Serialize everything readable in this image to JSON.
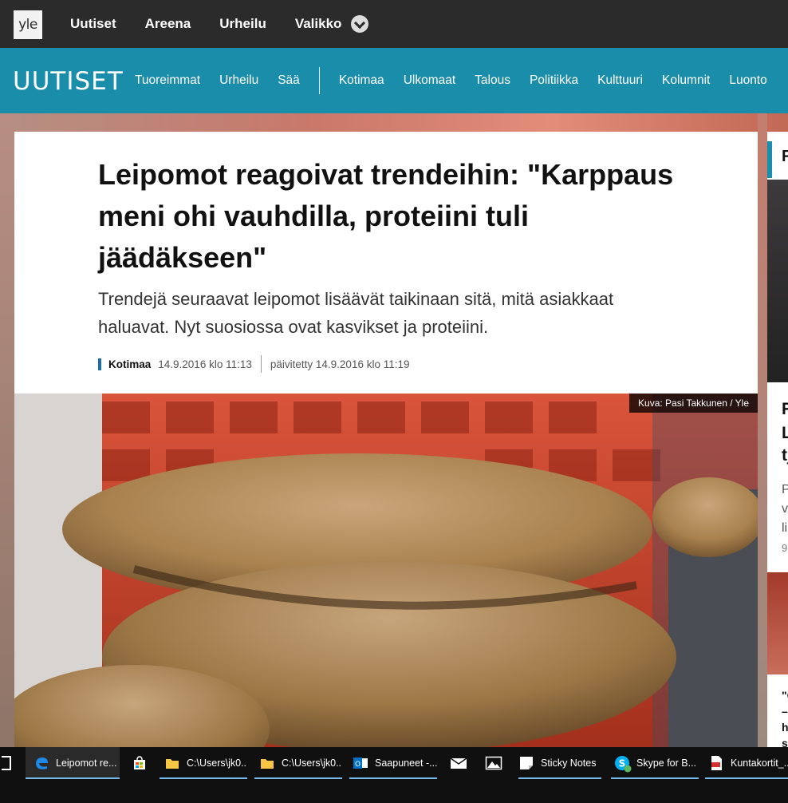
{
  "topbar": {
    "logo": "yle",
    "nav": [
      "Uutiset",
      "Areena",
      "Urheilu"
    ],
    "menu_label": "Valikko"
  },
  "section_bar": {
    "logo": "UUTISET",
    "nav_left": [
      "Tuoreimmat",
      "Urheilu",
      "Sää"
    ],
    "nav_right": [
      "Kotimaa",
      "Ulkomaat",
      "Talous",
      "Politiikka",
      "Kulttuuri",
      "Kolumnit",
      "Luonto"
    ]
  },
  "article": {
    "headline": "Leipomot reagoivat trendeihin: \"Karppaus meni ohi vauhdilla, proteiini tuli jäädäkseen\"",
    "lead": "Trendejä seuraavat leipomot lisäävät taikinaan sitä, mitä asiakkaat haluavat. Nyt suosiossa ovat kasvikset ja proteiini.",
    "category": "Kotimaa",
    "published": "14.9.2016 klo 11:13",
    "updated": "päivitetty 14.9.2016 klo 11:19",
    "photo_credit": "Kuva: Pasi Takkunen / Yle"
  },
  "sidebar": {
    "fragments": [
      "F",
      "L",
      "tj",
      "P",
      "v",
      "li",
      "9",
      "\"C",
      "–",
      "h",
      "s"
    ]
  },
  "taskbar": {
    "items": [
      {
        "label": "Leipomot re...",
        "icon": "edge-icon"
      },
      {
        "label": "",
        "icon": "store-icon"
      },
      {
        "label": "C:\\Users\\jk0...",
        "icon": "folder-icon"
      },
      {
        "label": "C:\\Users\\jk0...",
        "icon": "folder-icon"
      },
      {
        "label": "Saapuneet -...",
        "icon": "outlook-icon"
      },
      {
        "label": "",
        "icon": "mail-icon"
      },
      {
        "label": "",
        "icon": "photos-icon"
      },
      {
        "label": "Sticky Notes",
        "icon": "sticky-notes-icon"
      },
      {
        "label": "Skype for B...",
        "icon": "skype-icon"
      },
      {
        "label": "Kuntakortit_...",
        "icon": "pdf-icon"
      }
    ]
  },
  "colors": {
    "topbar": "#2b2b2b",
    "section_bar": "#1a8daa",
    "category_accent": "#1a6db0",
    "taskbar": "#101010"
  }
}
